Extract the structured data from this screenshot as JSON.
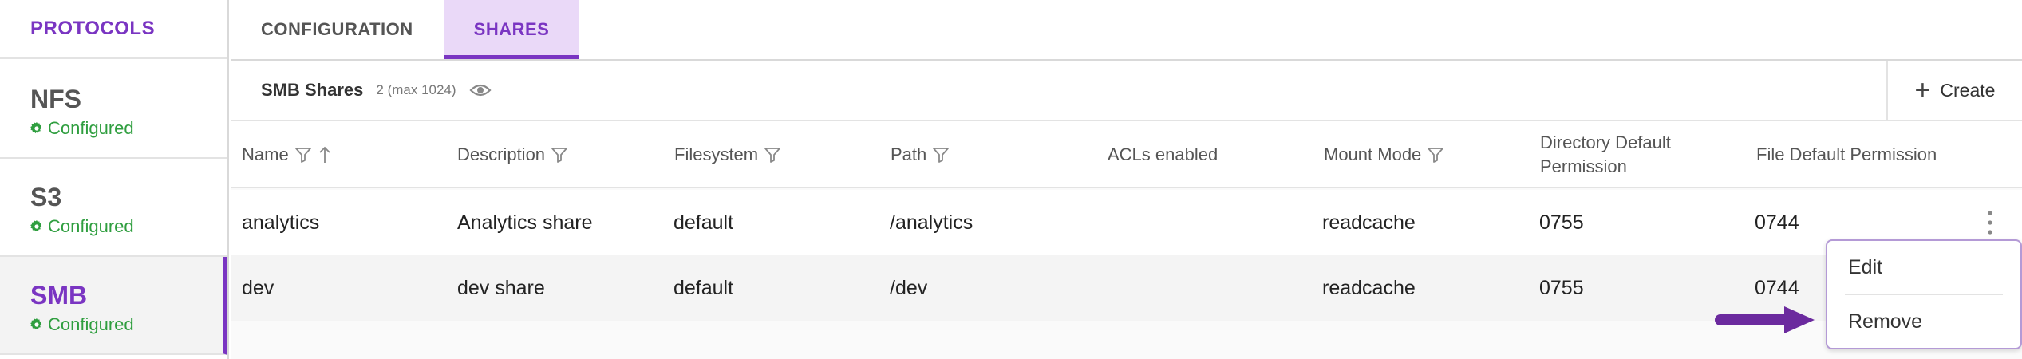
{
  "sidebar": {
    "header": "PROTOCOLS",
    "items": [
      {
        "name": "NFS",
        "status": "Configured"
      },
      {
        "name": "S3",
        "status": "Configured"
      },
      {
        "name": "SMB",
        "status": "Configured"
      }
    ]
  },
  "tabs": [
    "CONFIGURATION",
    "SHARES"
  ],
  "active_tab": "SHARES",
  "panel": {
    "title": "SMB Shares",
    "count": "2 (max 1024)",
    "create_label": "Create"
  },
  "table": {
    "columns": [
      "Name",
      "Description",
      "Filesystem",
      "Path",
      "ACLs enabled",
      "Mount Mode",
      "Directory Default Permission",
      "File Default Permission"
    ],
    "column_dir_line1": "Directory Default",
    "column_dir_line2": "Permission",
    "rows": [
      {
        "name": "analytics",
        "description": "Analytics share",
        "filesystem": "default",
        "path": "/analytics",
        "acls": "",
        "mount_mode": "readcache",
        "dir_perm": "0755",
        "file_perm": "0744"
      },
      {
        "name": "dev",
        "description": "dev share",
        "filesystem": "default",
        "path": "/dev",
        "acls": "",
        "mount_mode": "readcache",
        "dir_perm": "0755",
        "file_perm": "0744"
      }
    ]
  },
  "context_menu": {
    "items": [
      "Edit",
      "Remove"
    ]
  },
  "colors": {
    "accent": "#7a35c2",
    "status_green": "#2f9e3f",
    "annotation_arrow": "#6b2a9e"
  }
}
